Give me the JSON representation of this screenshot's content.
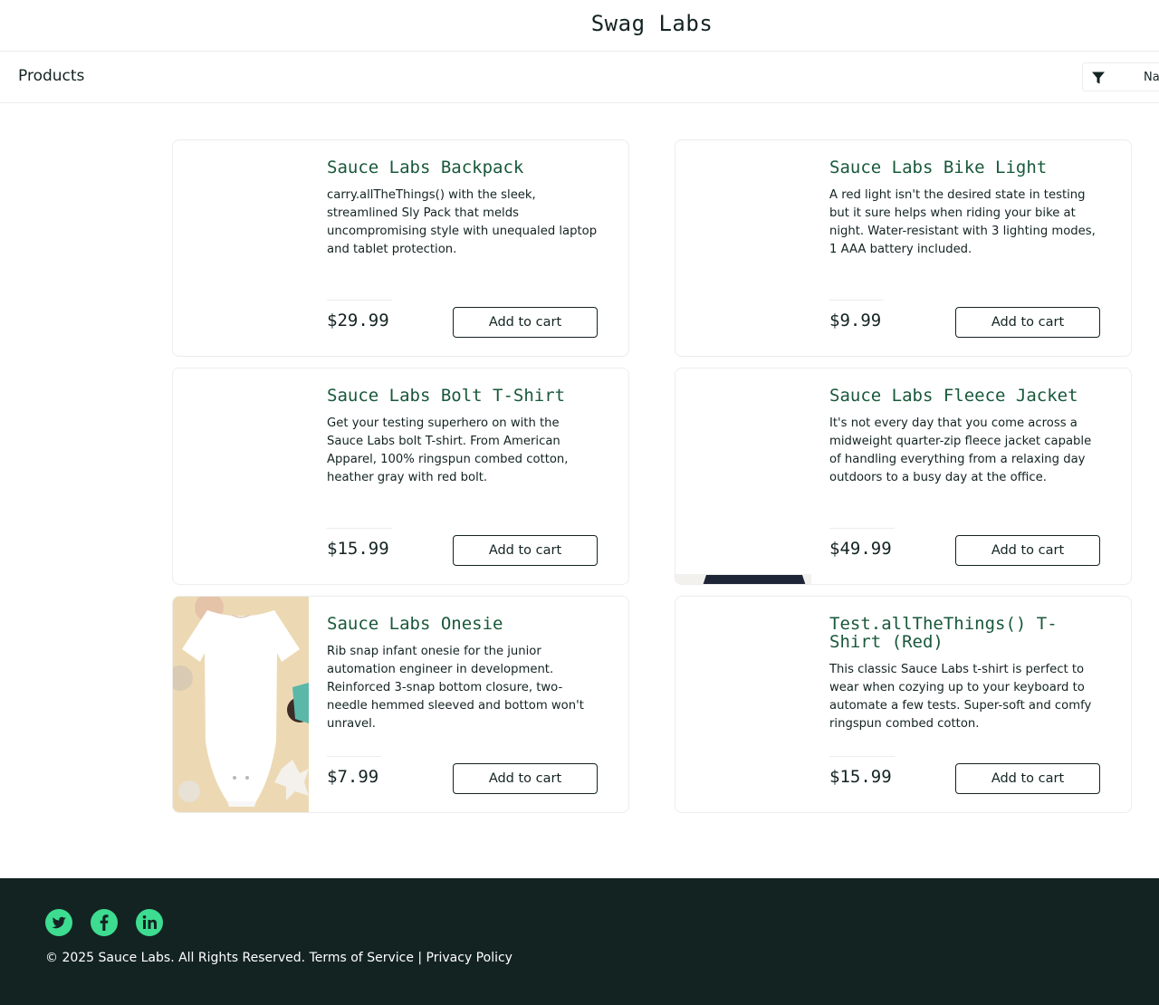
{
  "header": {
    "app_logo": "Swag Labs"
  },
  "secondary": {
    "title": "Products",
    "sort": {
      "icon": "filter-icon",
      "value": "Name (A to Z)"
    }
  },
  "products": [
    {
      "name": "Sauce Labs Backpack",
      "desc": "carry.allTheThings() with the sleek, streamlined Sly Pack that melds uncompromising style with unequaled laptop and tablet protection.",
      "price": "$29.99",
      "button": "Add to cart"
    },
    {
      "name": "Sauce Labs Bike Light",
      "desc": "A red light isn't the desired state in testing but it sure helps when riding your bike at night. Water-resistant with 3 lighting modes, 1 AAA battery included.",
      "price": "$9.99",
      "button": "Add to cart"
    },
    {
      "name": "Sauce Labs Bolt T-Shirt",
      "desc": "Get your testing superhero on with the Sauce Labs bolt T-shirt. From American Apparel, 100% ringspun combed cotton, heather gray with red bolt.",
      "price": "$15.99",
      "button": "Add to cart"
    },
    {
      "name": "Sauce Labs Fleece Jacket",
      "desc": "It's not every day that you come across a midweight quarter-zip fleece jacket capable of handling everything from a relaxing day outdoors to a busy day at the office.",
      "price": "$49.99",
      "button": "Add to cart"
    },
    {
      "name": "Sauce Labs Onesie",
      "desc": "Rib snap infant onesie for the junior automation engineer in development. Reinforced 3-snap bottom closure, two-needle hemmed sleeved and bottom won't unravel.",
      "price": "$7.99",
      "button": "Add to cart"
    },
    {
      "name": "Test.allTheThings() T-Shirt (Red)",
      "desc": "This classic Sauce Labs t-shirt is perfect to wear when cozying up to your keyboard to automate a few tests. Super-soft and comfy ringspun combed cotton.",
      "price": "$15.99",
      "button": "Add to cart"
    }
  ],
  "footer": {
    "social": [
      "twitter-icon",
      "facebook-icon",
      "linkedin-icon"
    ],
    "copy": "© 2025 Sauce Labs. All Rights Reserved. Terms of Service | Privacy Policy"
  },
  "colors": {
    "accent_green": "#3ddc91",
    "title_green": "#18583a",
    "footer_bg": "#132322"
  }
}
